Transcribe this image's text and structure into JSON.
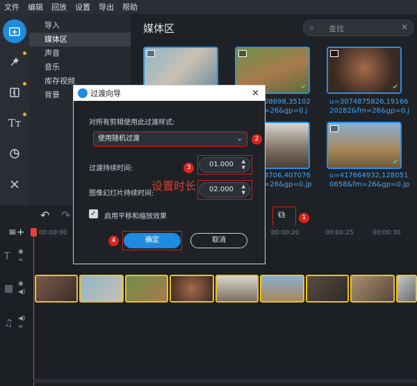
{
  "menu": [
    "文件",
    "编辑",
    "回放",
    "设置",
    "导出",
    "帮助"
  ],
  "rail_icons": [
    "add-media-icon",
    "magic-wand-icon",
    "transition-icon",
    "text-icon",
    "sticker-icon",
    "tools-icon"
  ],
  "categories": [
    {
      "label": "导入",
      "selected": false
    },
    {
      "label": "媒体区",
      "selected": true
    },
    {
      "label": "声音",
      "selected": false
    },
    {
      "label": "音乐",
      "selected": false
    },
    {
      "label": "库存视频",
      "selected": false
    },
    {
      "label": "背景",
      "selected": false
    }
  ],
  "media": {
    "title": "媒体区",
    "search_placeholder": "查找",
    "captions": [
      "08698,35102\n=26&gp=0.j",
      "u=3074875826,19166\n20282&fm=26&gp=0.j",
      "3706,407076\n=26&gp=0.jp",
      "u=417664932,128051\n0658&fm=26&gp=0.jp"
    ]
  },
  "dialog": {
    "title": "过渡向导",
    "apply_label": "对所有剪辑使用此过渡样式:",
    "style_value": "使用随机过渡",
    "duration_label": "过渡持续时间:",
    "duration_value": "01.000",
    "slide_label": "图像幻灯片持续时间:",
    "slide_value": "02.000",
    "panzoom_label": "启用平移和缩放效果",
    "ok_label": "确定",
    "cancel_label": "取消"
  },
  "annotation": {
    "set_duration": "设置时长",
    "badges": [
      "1",
      "2",
      "3",
      "4"
    ]
  },
  "ruler": [
    "00:00:00",
    "00:00:20",
    "00:00:25",
    "00:00:30"
  ],
  "colors": {
    "accent": "#1f8be0",
    "highlight_red": "#cc1f1f",
    "clip_border": "#f1c21b",
    "playhead": "#e8413b"
  }
}
